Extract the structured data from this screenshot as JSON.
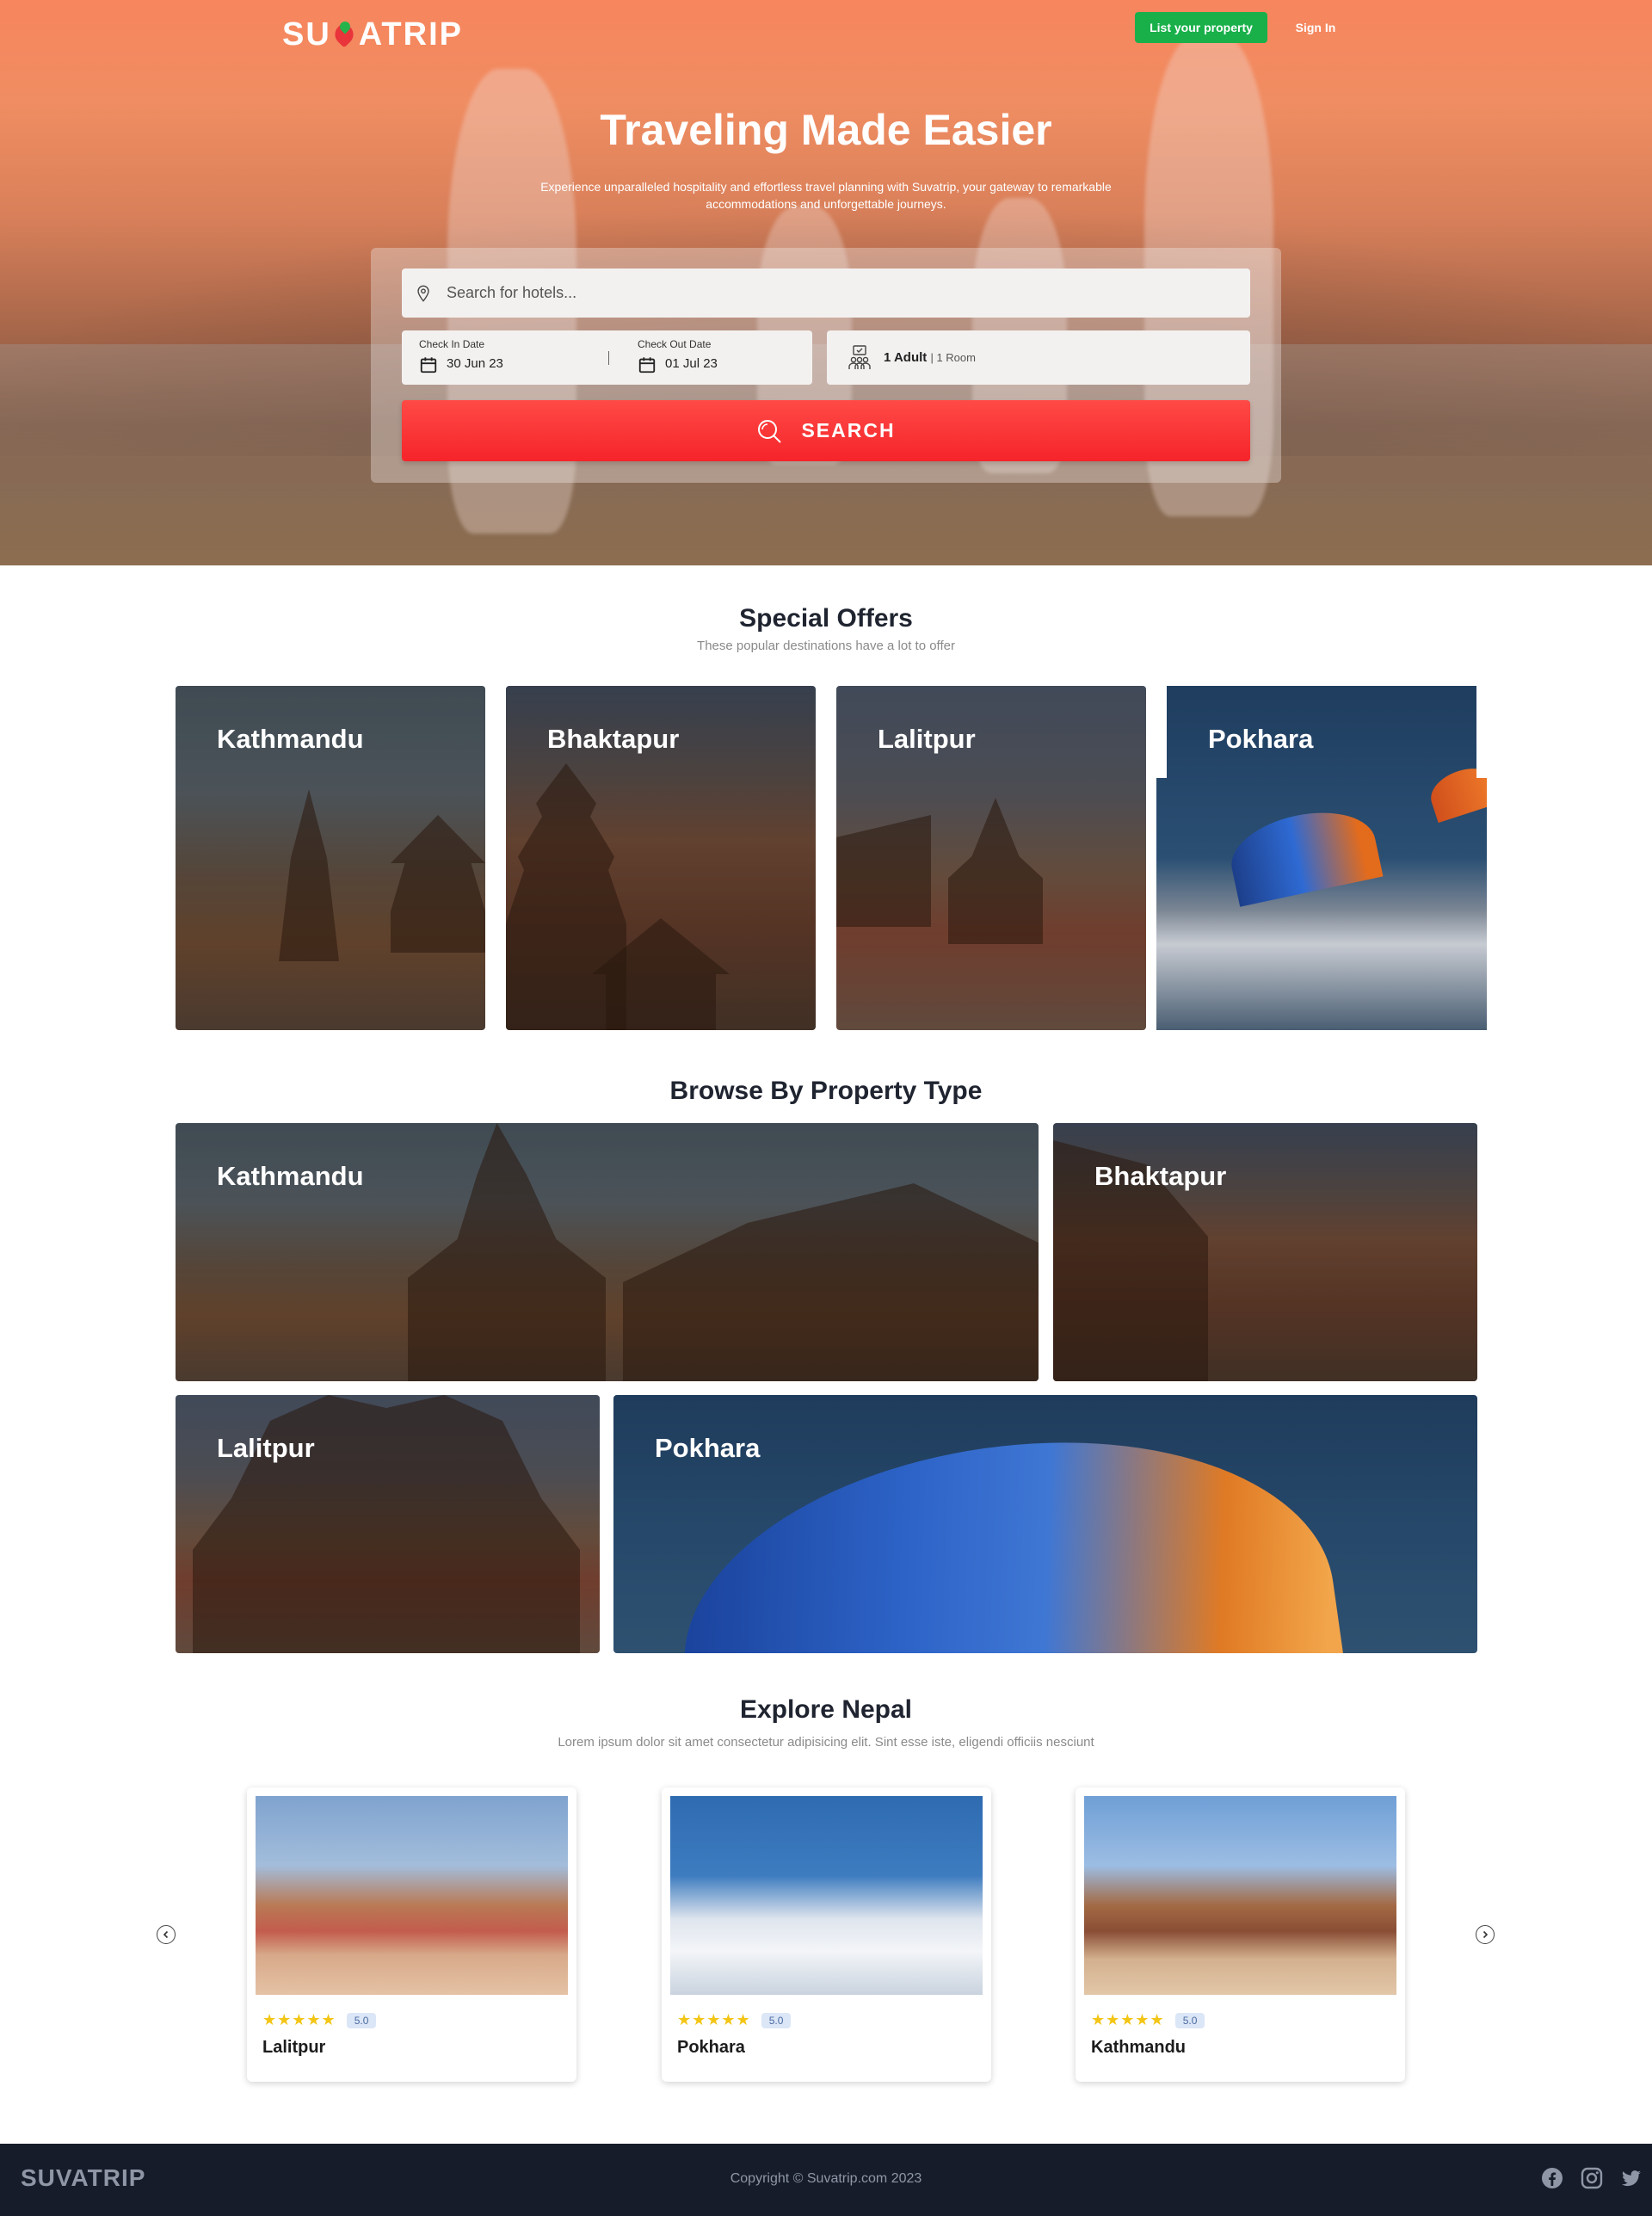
{
  "header": {
    "logo": "SUVATRIP",
    "list_property": "List your property",
    "sign_in": "Sign In"
  },
  "hero": {
    "title": "Traveling Made Easier",
    "subtitle": "Experience unparalleled hospitality and effortless travel planning with Suvatrip, your gateway to remarkable accommodations and unforgettable journeys."
  },
  "search": {
    "placeholder": "Search for hotels...",
    "check_in_label": "Check In Date",
    "check_in_value": "30 Jun 23",
    "check_out_label": "Check Out Date",
    "check_out_value": "01 Jul 23",
    "guests_adult": "1 Adult",
    "guests_room": "| 1 Room",
    "button": "SEARCH"
  },
  "special_offers": {
    "title": "Special Offers",
    "subtitle": "These popular destinations have a lot to offer",
    "items": [
      "Kathmandu",
      "Bhaktapur",
      "Lalitpur",
      "Pokhara"
    ]
  },
  "property_type": {
    "title": "Browse By Property Type",
    "items": [
      "Kathmandu",
      "Bhaktapur",
      "Lalitpur",
      "Pokhara"
    ]
  },
  "explore": {
    "title": "Explore Nepal",
    "subtitle": "Lorem ipsum dolor sit amet consectetur adipisicing elit. Sint esse iste, eligendi officiis nesciunt",
    "cards": [
      {
        "name": "Lalitpur",
        "stars": "★★★★★",
        "score": "5.0"
      },
      {
        "name": "Pokhara",
        "stars": "★★★★★",
        "score": "5.0"
      },
      {
        "name": "Kathmandu",
        "stars": "★★★★★",
        "score": "5.0"
      }
    ]
  },
  "footer": {
    "logo": "SUVATRIP",
    "copyright": "Copyright © Suvatrip.com 2023"
  },
  "icons": {
    "location": "map-pin-icon",
    "calendar": "calendar-icon",
    "guests": "guests-icon",
    "search": "search-icon",
    "prev": "chevron-left-icon",
    "next": "chevron-right-icon",
    "social": [
      "facebook-icon",
      "instagram-icon",
      "twitter-icon"
    ]
  },
  "colors": {
    "accent_green": "#19b04a",
    "accent_red": "#f5242a",
    "footer_bg": "#161c2a",
    "star": "#f3c515"
  }
}
